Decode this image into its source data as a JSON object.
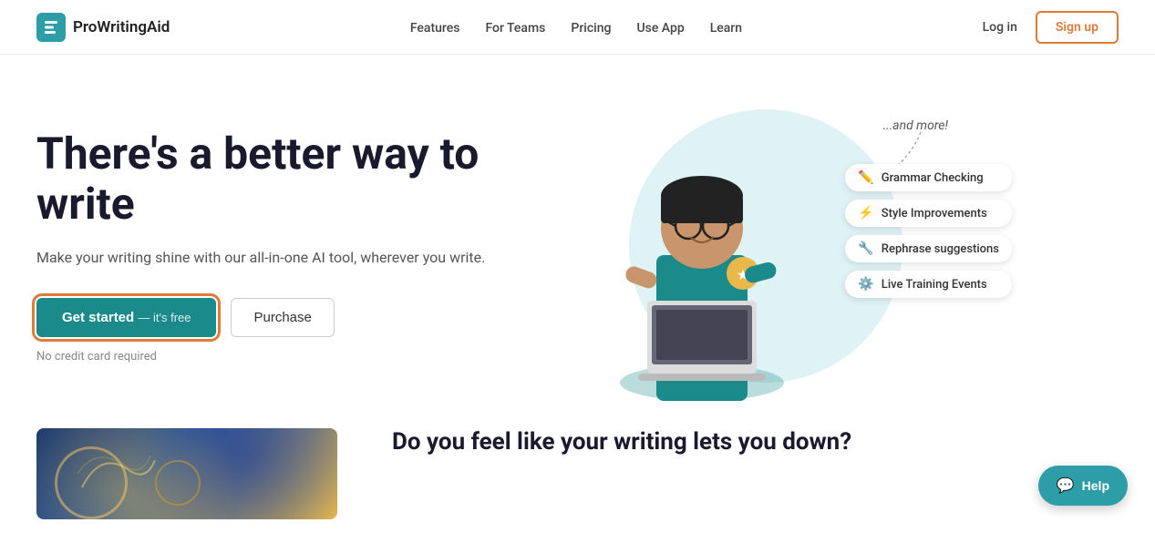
{
  "brand": {
    "name": "ProWritingAid",
    "logo_alt": "ProWritingAid logo"
  },
  "nav": {
    "links": [
      {
        "label": "Features",
        "id": "features"
      },
      {
        "label": "For Teams",
        "id": "for-teams"
      },
      {
        "label": "Pricing",
        "id": "pricing"
      },
      {
        "label": "Use App",
        "id": "use-app"
      },
      {
        "label": "Learn",
        "id": "learn"
      }
    ],
    "login_label": "Log in",
    "signup_label": "Sign up"
  },
  "hero": {
    "title": "There's a better way to write",
    "subtitle": "Make your writing shine with our all-in-one AI tool, wherever you write.",
    "cta_label": "Get started",
    "cta_suffix": "— it's free",
    "purchase_label": "Purchase",
    "no_credit": "No credit card required",
    "and_more": "...and more!",
    "features": [
      {
        "id": "grammar",
        "icon": "✏️",
        "label": "Grammar Checking"
      },
      {
        "id": "style",
        "icon": "⚡",
        "label": "Style Improvements"
      },
      {
        "id": "rephrase",
        "icon": "🔧",
        "label": "Rephrase suggestions"
      },
      {
        "id": "training",
        "icon": "⚙️",
        "label": "Live Training Events"
      }
    ]
  },
  "bottom": {
    "question": "Do you feel like your writing lets you down?"
  },
  "help": {
    "label": "Help"
  },
  "colors": {
    "teal": "#1a8a8a",
    "orange": "#e07b39",
    "light_teal": "#dff2f5"
  }
}
